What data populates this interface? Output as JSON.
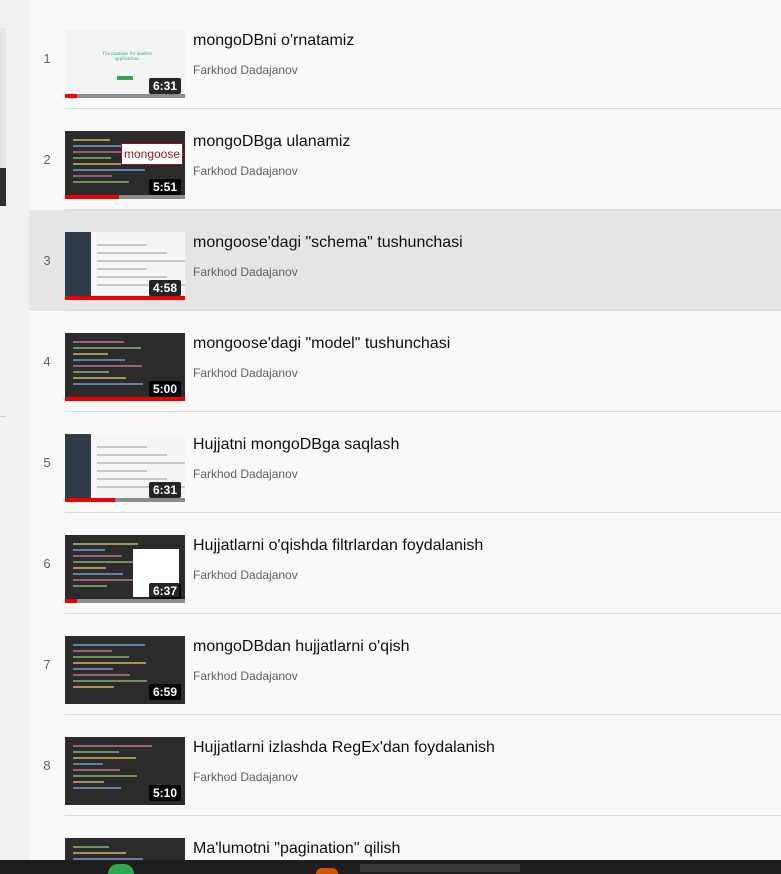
{
  "playlist": {
    "items": [
      {
        "index": "1",
        "title": "mongoDBni o'rnatamiz",
        "channel": "Farkhod Dadajanov",
        "duration": "6:31",
        "progress": 0.1,
        "style": "light"
      },
      {
        "index": "2",
        "title": "mongoDBga ulanamiz",
        "channel": "Farkhod Dadajanov",
        "duration": "5:51",
        "progress": 0.45,
        "style": "dark"
      },
      {
        "index": "3",
        "title": "mongoose'dagi \"schema\" tushunchasi",
        "channel": "Farkhod Dadajanov",
        "duration": "4:58",
        "progress": 1.0,
        "style": "app",
        "active": true
      },
      {
        "index": "4",
        "title": "mongoose'dagi \"model\" tushunchasi",
        "channel": "Farkhod Dadajanov",
        "duration": "5:00",
        "progress": 1.0,
        "style": "dark"
      },
      {
        "index": "5",
        "title": "Hujjatni mongoDBga saqlash",
        "channel": "Farkhod Dadajanov",
        "duration": "6:31",
        "progress": 0.42,
        "style": "app"
      },
      {
        "index": "6",
        "title": "Hujjatlarni o'qishda filtrlardan foydalanish",
        "channel": "Farkhod Dadajanov",
        "duration": "6:37",
        "progress": 0.1,
        "style": "dark"
      },
      {
        "index": "7",
        "title": "mongoDBdan hujjatlarni o'qish",
        "channel": "Farkhod Dadajanov",
        "duration": "6:59",
        "progress": 0,
        "style": "dark"
      },
      {
        "index": "8",
        "title": "Hujjatlarni izlashda RegEx'dan foydalanish",
        "channel": "Farkhod Dadajanov",
        "duration": "5:10",
        "progress": 0,
        "style": "dark"
      },
      {
        "index": "",
        "title": "Ma'lumotni \"pagination\" qilish",
        "channel": "",
        "duration": "",
        "progress": 0,
        "style": "dark"
      }
    ]
  },
  "thumb_text": {
    "mongoose_logo": "mongoose",
    "web_headline": "The database for modern applications"
  },
  "colors": {
    "progress": "#ee0000",
    "active_row": "#e5e5e5"
  }
}
